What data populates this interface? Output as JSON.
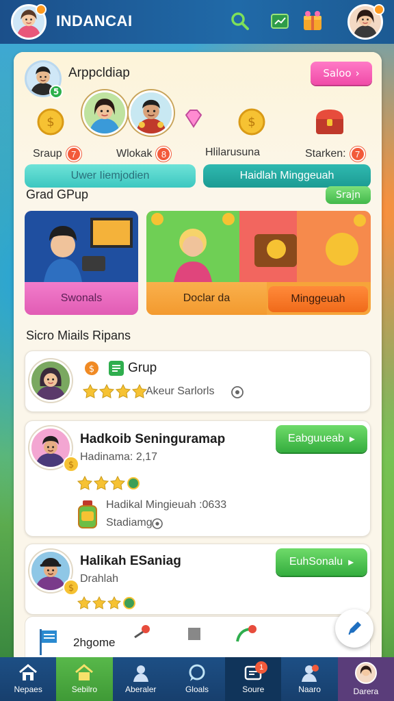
{
  "app": {
    "title": "INDANCAI"
  },
  "colors": {
    "accent_green": "#42b84a",
    "accent_pink": "#f04ba8",
    "nav_bg": "#1d4f85",
    "badge_red": "#f25a3a"
  },
  "topbar": {
    "icons": [
      "search-icon",
      "chart-icon",
      "gift-icon"
    ]
  },
  "profile": {
    "name": "Arppcldiap",
    "badge": "5",
    "action_label": "Saloo"
  },
  "shop": {
    "items": [
      {
        "label": "Sraup",
        "count": "7",
        "icon": "coin-icon"
      },
      {
        "label": "Wlokak",
        "count": "8",
        "icon": "coin-icon"
      },
      {
        "label": "Hlilarusuna",
        "count": "",
        "icon": "coin-icon"
      },
      {
        "label": "Starken:",
        "count": "7",
        "icon": "chest-icon"
      }
    ]
  },
  "pills": {
    "left": "Uwer Iiemjodien",
    "right": "Haidlah Minggeuah"
  },
  "grad_group": {
    "title": "Grad GPup",
    "action": "Srajn"
  },
  "promos": {
    "left": {
      "footer": "Swonals"
    },
    "right": {
      "footer_left": "Doclar da",
      "footer_button": "Minggeuah"
    }
  },
  "list_section": {
    "title": "Sicro Miails Ripans"
  },
  "rows": [
    {
      "title": "Grup",
      "sub": "Akeur Sarlorls",
      "stars": 4
    },
    {
      "title": "Hadkoib Seninguramap",
      "sub": "Hadinama: 2,17",
      "button": "Eabguueab",
      "stars": 3,
      "detail_line1": "Hadikal Mingieuah :0633",
      "detail_line2": "Stadiamg"
    },
    {
      "title": "Halikah ESaniag",
      "sub": "Drahlah",
      "button": "EuhSonalu",
      "stars": 3
    }
  ],
  "partial_card": {
    "label": "2hgome"
  },
  "nav": {
    "items": [
      {
        "label": "Nepaes",
        "icon": "home-icon"
      },
      {
        "label": "Sebilro",
        "icon": "store-icon"
      },
      {
        "label": "Aberaler",
        "icon": "user-icon"
      },
      {
        "label": "Gloals",
        "icon": "chat-icon"
      },
      {
        "label": "Soure",
        "icon": "inbox-icon",
        "badge": "1"
      },
      {
        "label": "Naaro",
        "icon": "profile-icon"
      },
      {
        "label": "Darera",
        "icon": "avatar-icon"
      }
    ]
  }
}
